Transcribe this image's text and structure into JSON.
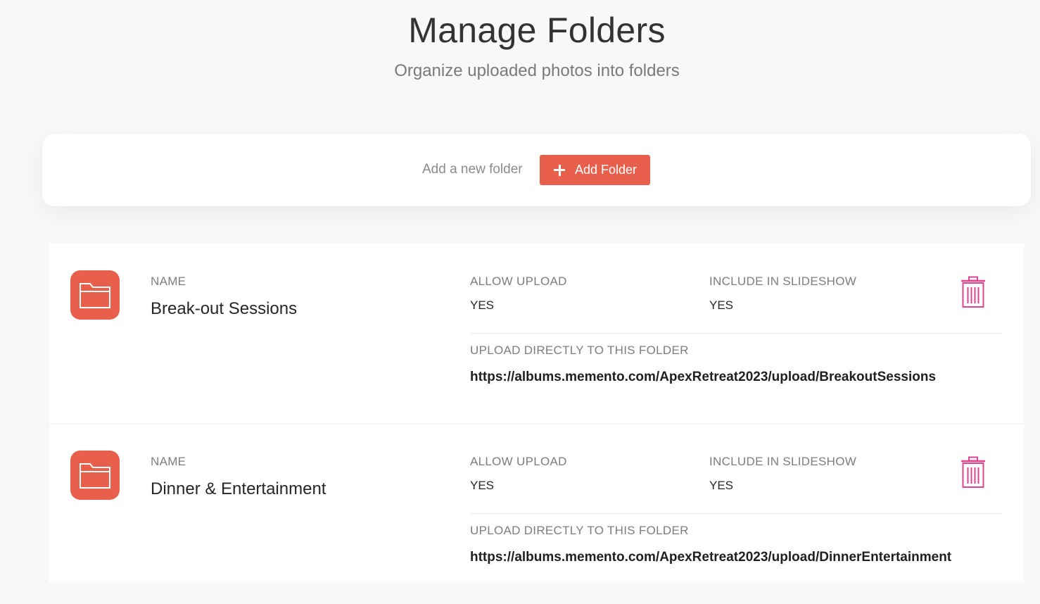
{
  "header": {
    "title": "Manage Folders",
    "subtitle": "Organize uploaded photos into folders"
  },
  "add_folder": {
    "label": "Add a new folder",
    "button_label": "Add Folder",
    "button_icon": "plus-icon"
  },
  "colors": {
    "accent": "#e8604c",
    "delete": "#e0448e"
  },
  "folders": [
    {
      "icon": "folder-icon",
      "name_label": "NAME",
      "name": "Break-out Sessions",
      "allow_upload_label": "ALLOW UPLOAD",
      "allow_upload": "YES",
      "slideshow_label": "INCLUDE IN SLIDESHOW",
      "slideshow": "YES",
      "direct_label": "UPLOAD DIRECTLY TO THIS FOLDER",
      "direct_url": "https://albums.memento.com/ApexRetreat2023/upload/BreakoutSessions",
      "delete_icon": "trash-icon"
    },
    {
      "icon": "folder-icon",
      "name_label": "NAME",
      "name": "Dinner & Entertainment",
      "allow_upload_label": "ALLOW UPLOAD",
      "allow_upload": "YES",
      "slideshow_label": "INCLUDE IN SLIDESHOW",
      "slideshow": "YES",
      "direct_label": "UPLOAD DIRECTLY TO THIS FOLDER",
      "direct_url": "https://albums.memento.com/ApexRetreat2023/upload/DinnerEntertainment",
      "delete_icon": "trash-icon"
    }
  ]
}
